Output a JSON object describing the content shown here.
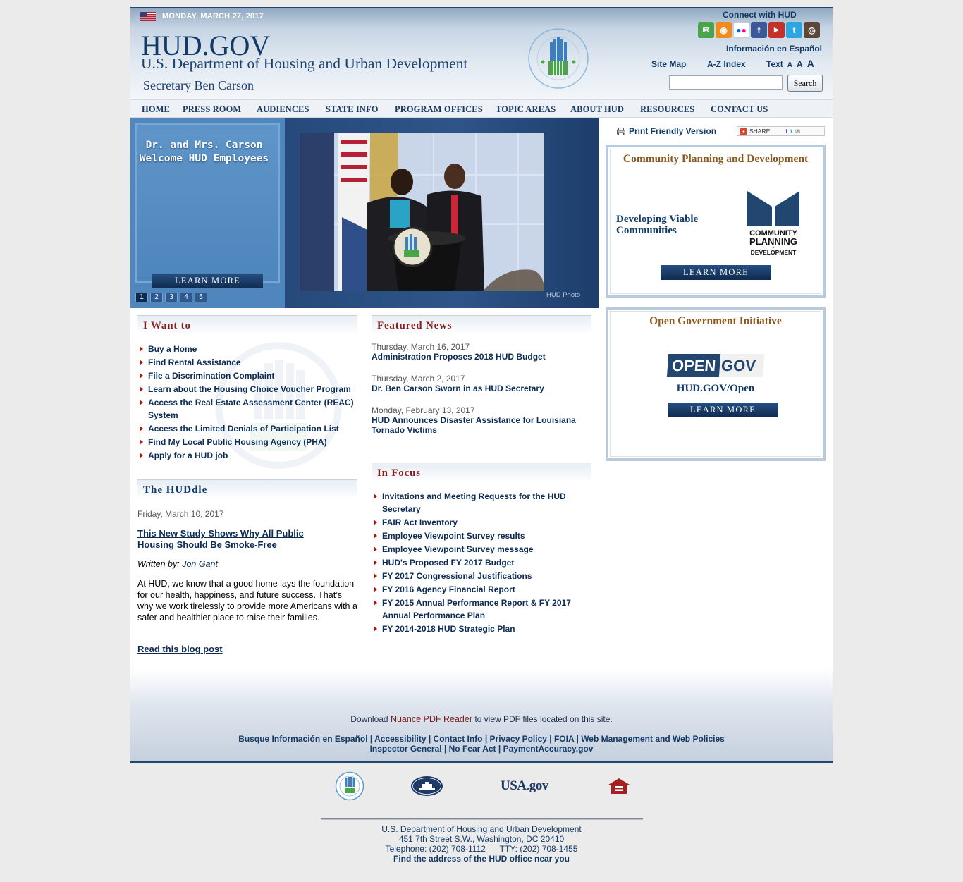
{
  "header": {
    "date": "MONDAY, MARCH 27, 2017",
    "title": "HUD.GOV",
    "subtitle": "U.S. Department of Housing and Urban Development",
    "secretary": "Secretary Ben Carson",
    "connect": "Connect with HUD",
    "social_icons": [
      "email-icon",
      "rss-icon",
      "flickr-icon",
      "facebook-icon",
      "youtube-icon",
      "twitter-icon",
      "instagram-icon"
    ],
    "espanol": "Información en Español",
    "site_map": "Site Map",
    "az_index": "A-Z Index",
    "text_label": "Text",
    "text_sizes": [
      "A",
      "A",
      "A"
    ],
    "search_value": "",
    "search_button": "Search"
  },
  "nav": [
    "HOME",
    "PRESS ROOM",
    "AUDIENCES",
    "STATE INFO",
    "PROGRAM OFFICES",
    "TOPIC AREAS",
    "ABOUT HUD",
    "RESOURCES",
    "CONTACT US"
  ],
  "hero": {
    "caption": "Dr. and Mrs. Carson Welcome HUD Employees",
    "learn_more": "LEARN MORE",
    "pages": [
      "1",
      "2",
      "3",
      "4",
      "5"
    ],
    "active_page": 1,
    "photo_credit": "HUD Photo"
  },
  "sidebar": {
    "print": "Print Friendly Version",
    "share": "SHARE",
    "cpd": {
      "title": "Community Planning and Development",
      "text": "Developing Viable Communities",
      "logo_lines": [
        "COMMUNITY",
        "PLANNING",
        "DEVELOPMENT"
      ],
      "logo_small": "&",
      "learn_more": "LEARN MORE"
    },
    "open_gov": {
      "title": "Open Government Initiative",
      "logo_left": "OPEN",
      "logo_right": "GOV",
      "link": "HUD.GOV/Open",
      "learn_more": "LEARN MORE"
    }
  },
  "i_want_to": {
    "heading": "I Want to",
    "items": [
      "Buy a Home",
      "Find Rental Assistance",
      "File a Discrimination Complaint",
      "Learn about the Housing Choice Voucher Program",
      "Access the Real Estate Assessment Center (REAC) System",
      "Access the Limited Denials of Participation List",
      "Find My Local Public Housing Agency (PHA)",
      "Apply for a HUD job"
    ]
  },
  "huddle": {
    "heading": "The HUDdle",
    "date": "Friday, March 10, 2017",
    "title": "This New Study Shows Why All Public Housing Should Be Smoke-Free",
    "written_by": "Written by:",
    "author": "Jon Gant",
    "body": "At HUD, we know that a good home lays the foundation for our health, happiness, and future success.  That’s why we work tirelessly to provide more Americans with a safer and healthier place to raise their families.",
    "read_more": "Read this blog post"
  },
  "featured_news": {
    "heading": "Featured News",
    "items": [
      {
        "date": "Thursday, March 16, 2017",
        "title": "Administration Proposes 2018 HUD Budget"
      },
      {
        "date": "Thursday, March 2, 2017",
        "title": "Dr. Ben Carson Sworn in as HUD Secretary"
      },
      {
        "date": "Monday, February 13, 2017",
        "title": "HUD Announces Disaster Assistance for Louisiana Tornado Victims"
      }
    ]
  },
  "in_focus": {
    "heading": "In Focus",
    "items": [
      "Invitations and Meeting Requests for the HUD Secretary",
      "FAIR Act Inventory",
      "Employee Viewpoint Survey results",
      "Employee Viewpoint Survey message",
      "HUD's Proposed FY 2017 Budget",
      "FY 2017 Congressional Justifications",
      "FY 2016 Agency Financial Report",
      "FY 2015 Annual Performance Report & FY 2017 Annual Performance Plan",
      "FY 2014-2018 HUD Strategic Plan"
    ]
  },
  "footer": {
    "download_prefix": "Download",
    "download_link": "Nuance PDF Reader",
    "download_suffix": "to view PDF files located on this site.",
    "links_row1": "Busque Información en Español | Accessibility | Contact Info | Privacy Policy | FOIA | Web Management and Web Policies",
    "links_row2": "Inspector General | No Fear Act | PaymentAccuracy.gov",
    "logos": [
      "hud-seal-icon",
      "white-house-icon",
      "usa-gov-icon",
      "equal-housing-icon"
    ],
    "usagov_text": "USA.gov",
    "address": [
      "U.S. Department of Housing and Urban Development",
      "451 7th Street S.W., Washington, DC 20410",
      "Telephone: (202) 708-1112      TTY: (202) 708-1455"
    ],
    "find_office": "Find the address of the HUD office near you"
  },
  "colors": {
    "navy": "#0b2b56",
    "maroon": "#8a1e1e",
    "brown": "#8a5a23",
    "hero_blue": "#4e86bd"
  }
}
